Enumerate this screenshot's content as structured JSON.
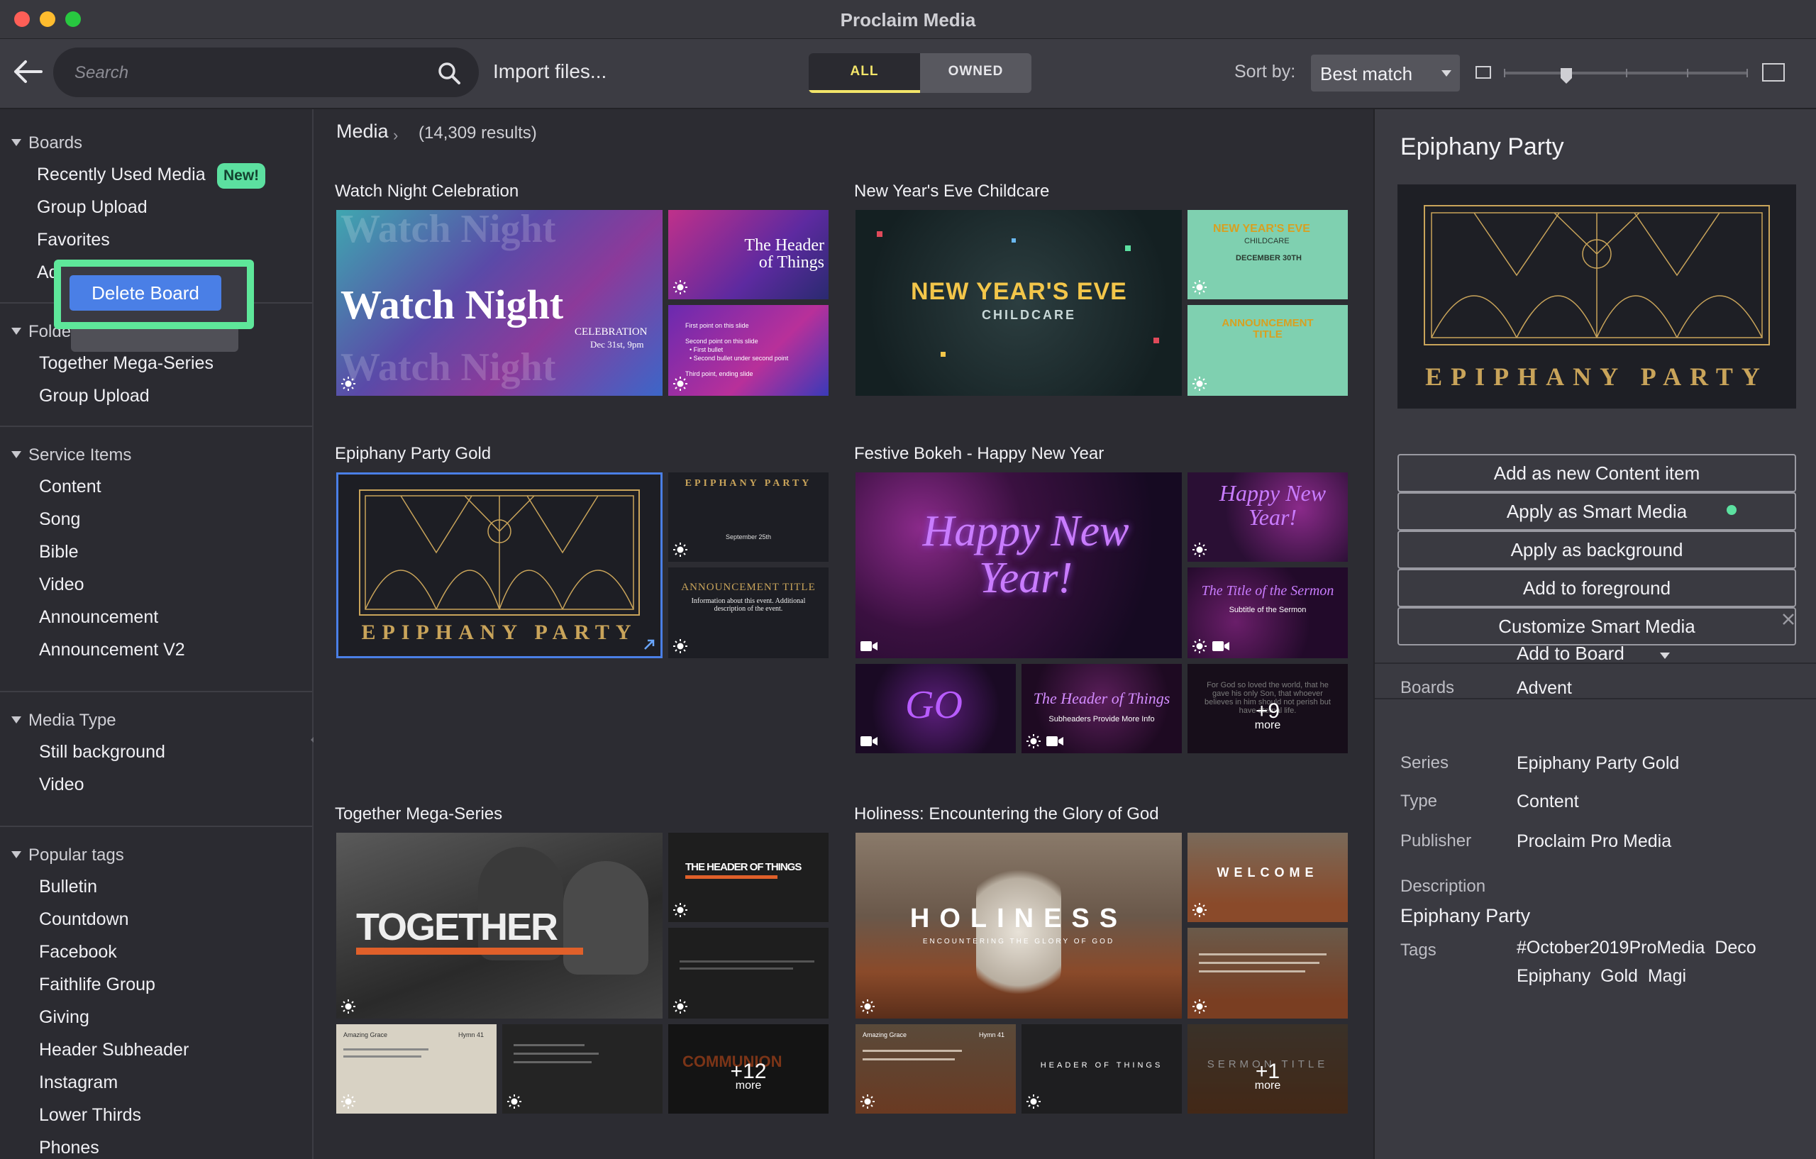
{
  "window": {
    "title": "Proclaim Media"
  },
  "toolbar": {
    "search_placeholder": "Search",
    "import_label": "Import files...",
    "filter_all": "ALL",
    "filter_owned": "OWNED",
    "sort_label": "Sort by:",
    "sort_value": "Best match",
    "thumbnail_size_level": 0.25
  },
  "sidebar": {
    "boards": {
      "heading": "Boards",
      "items": [
        "Recently Used Media",
        "Group Upload",
        "Favorites",
        "Advent"
      ],
      "new_badge": "New!"
    },
    "context_menu": {
      "delete_label": "Delete Board"
    },
    "folders": {
      "heading": "Folders",
      "items": [
        "Together Mega-Series",
        "Group Upload"
      ]
    },
    "service_items": {
      "heading": "Service Items",
      "items": [
        "Content",
        "Song",
        "Bible",
        "Video",
        "Announcement",
        "Announcement V2"
      ]
    },
    "media_type": {
      "heading": "Media Type",
      "items": [
        "Still background",
        "Video"
      ]
    },
    "popular_tags": {
      "heading": "Popular tags",
      "items": [
        "Bulletin",
        "Countdown",
        "Facebook",
        "Faithlife Group",
        "Giving",
        "Header Subheader",
        "Instagram",
        "Lower Thirds",
        "Phones"
      ]
    }
  },
  "main": {
    "breadcrumb": "Media",
    "result_count": "(14,309 results)",
    "cards": [
      {
        "title": "Watch Night Celebration",
        "main_text": "Watch Night",
        "main_sub": "CELEBRATION",
        "main_date": "Dec 31st, 9pm",
        "tile1_text": "The Header of Things",
        "tile2_lines": [
          "First point on this slide",
          "Second point on this slide",
          "• First bullet",
          "• Second bullet under second point",
          "Third point, ending slide"
        ]
      },
      {
        "title": "New Year's Eve Childcare",
        "main_text": "NEW YEAR'S EVE",
        "main_sub": "CHILDCARE",
        "tile1_text": "NEW YEAR'S EVE",
        "tile1_sub": "CHILDCARE",
        "tile1_date": "DECEMBER 30TH",
        "tile2_text": "ANNOUNCEMENT TITLE"
      },
      {
        "title": "Epiphany Party Gold",
        "main_text": "EPIPHANY PARTY",
        "tile1_text": "EPIPHANY PARTY",
        "tile1_date": "September 25th",
        "tile2_text": "ANNOUNCEMENT TITLE",
        "tile2_sub": "Information about this event. Additional description of the event."
      },
      {
        "title": "Festive Bokeh - Happy New Year",
        "main_text": "Happy New Year!",
        "tile1_text": "Happy New Year!",
        "tile2_text": "The Title of the Sermon",
        "tile2_sub": "Subtitle of the Sermon",
        "tile3_text": "GO",
        "tile4_text": "The Header of Things",
        "tile4_sub": "Subheaders Provide More Info",
        "tile5_text": "For God so loved the world, that he gave his only Son, that whoever believes in him should not perish but have eternal life.",
        "more_count": "+9",
        "more_word": "more"
      },
      {
        "title": "Together Mega-Series",
        "main_text": "TOGETHER",
        "tile1_text": "THE HEADER OF THINGS",
        "tile3_text": "Amazing Grace",
        "tile3_hymn": "Hymn 41",
        "tile5_text": "COMMUNION",
        "more_count": "+12",
        "more_word": "more"
      },
      {
        "title": "Holiness: Encountering the Glory of God",
        "main_text": "HOLINESS",
        "main_sub": "ENCOUNTERING THE GLORY OF GOD",
        "tile1_text": "WELCOME",
        "tile3_text": "Amazing Grace",
        "tile3_hymn": "Hymn 41",
        "tile4_text": "HEADER OF THINGS",
        "tile5_text": "SERMON TITLE",
        "more_count": "+1",
        "more_word": "more"
      }
    ]
  },
  "detail": {
    "title": "Epiphany Party",
    "preview_text": "EPIPHANY PARTY",
    "actions": [
      "Add as new Content item",
      "Apply as Smart Media",
      "Apply as background",
      "Add to foreground",
      "Customize Smart Media"
    ],
    "boards_label": "Boards",
    "boards_value": "Advent",
    "add_to_board": "Add to Board",
    "series_label": "Series",
    "series_value": "Epiphany Party Gold",
    "type_label": "Type",
    "type_value": "Content",
    "publisher_label": "Publisher",
    "publisher_value": "Proclaim Pro Media",
    "description_label": "Description",
    "description_value": "Epiphany Party",
    "tags_label": "Tags",
    "tags_value": "#October2019ProMedia  Deco",
    "tags_value2": "Epiphany  Gold  Magi"
  },
  "colors": {
    "accent_yellow": "#f3e56a",
    "badge_green": "#5ce0a0",
    "highlight_green": "#5ee79a",
    "button_blue": "#4a7fe6",
    "gold": "#c9a45a"
  }
}
